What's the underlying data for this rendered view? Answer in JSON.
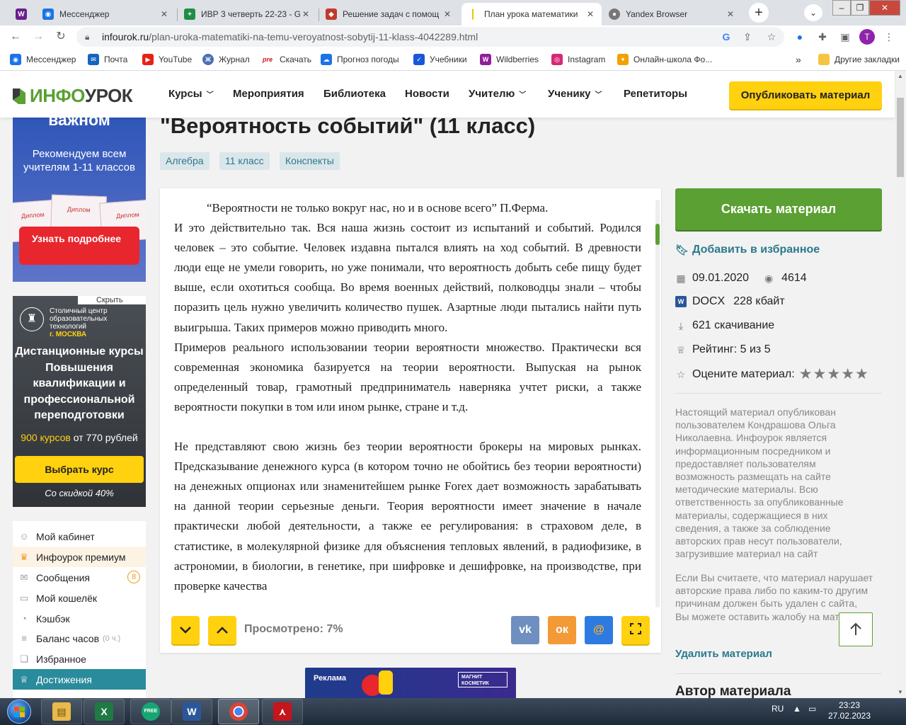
{
  "browser": {
    "tabs": [
      {
        "label": "",
        "icon": "W",
        "color": "#6b1e8c"
      },
      {
        "label": "Мессенджер",
        "icon": "◉",
        "color": "#1a73e8"
      },
      {
        "label": "ИВР 3 четверть 22-23 - G",
        "icon": "+",
        "color": "#1f8e45"
      },
      {
        "label": "Решение задач с помощ",
        "icon": "◆",
        "color": "#c0392b"
      },
      {
        "label": "План урока математики",
        "icon": "|",
        "color": "#f2c200"
      },
      {
        "label": "Yandex Browser",
        "icon": "●",
        "color": "#555555"
      }
    ],
    "active_tab": 4,
    "url_host": "infourok.ru",
    "url_path": "/plan-uroka-matematiki-na-temu-veroyatnost-sobytij-11-klass-4042289.html",
    "profile_letter": "T",
    "bookmarks": [
      {
        "label": "Мессенджер",
        "color": "#1a73e8",
        "icon": "◉"
      },
      {
        "label": "Почта",
        "color": "#1565c0",
        "icon": "✉"
      },
      {
        "label": "YouTube",
        "color": "#e62117",
        "icon": "▶"
      },
      {
        "label": "Журнал",
        "color": "#4a6fb5",
        "icon": "Ж"
      },
      {
        "label": "Скачать",
        "color": "#d7141a",
        "icon": "pre"
      },
      {
        "label": "Прогноз погоды",
        "color": "#1a73e8",
        "icon": "☁"
      },
      {
        "label": "Учебники",
        "color": "#1a56db",
        "icon": "✓"
      },
      {
        "label": "Wildberries",
        "color": "#8e1f9a",
        "icon": "W"
      },
      {
        "label": "Instagram",
        "color": "#d62976",
        "icon": "◎"
      },
      {
        "label": "Онлайн-школа Фо...",
        "color": "#f2a100",
        "icon": "✦"
      }
    ],
    "more_bookmarks": "»",
    "other_bookmarks": "Другие закладки"
  },
  "site": {
    "logo_info": "ИНФО",
    "logo_urok": "УРОК",
    "nav": [
      {
        "label": "Курсы",
        "dropdown": true
      },
      {
        "label": "Мероприятия",
        "dropdown": false
      },
      {
        "label": "Библиотека",
        "dropdown": false
      },
      {
        "label": "Новости",
        "dropdown": false
      },
      {
        "label": "Учителю",
        "dropdown": true
      },
      {
        "label": "Ученику",
        "dropdown": true
      },
      {
        "label": "Репетиторы",
        "dropdown": false
      }
    ],
    "publish_label": "Опубликовать материал"
  },
  "left_ads": {
    "ad1_heading": "важном",
    "ad1_sub": "Рекомендуем всем учителям 1-11 классов",
    "ad1_diploma": "Диплом",
    "ad1_cta": "Узнать подробнее",
    "ad2_hide": "Скрыть",
    "ad2_org": "Столичный центр образовательных технологий",
    "ad2_city": "г. МОСКВА",
    "ad2_title": "Дистанционные курсы Повышения квалификации и профессиональной переподготовки",
    "ad2_price_hl": "900 курсов",
    "ad2_price_rest": " от 770 рублей",
    "ad2_btn": "Выбрать курс",
    "ad2_discount": "Со скидкой 40%"
  },
  "user_menu": [
    {
      "label": "Мой кабинет",
      "icon": "☺",
      "muted": "",
      "badge": ""
    },
    {
      "label": "Инфоурок премиум",
      "icon": "♛",
      "muted": "",
      "badge": ""
    },
    {
      "label": "Сообщения",
      "icon": "✉",
      "muted": "",
      "badge": "8"
    },
    {
      "label": "Мой кошелёк",
      "icon": "▭",
      "muted": "",
      "badge": ""
    },
    {
      "label": "Кэшбэк",
      "icon": "◔",
      "muted": "",
      "badge": ""
    },
    {
      "label": "Баланс часов",
      "icon": "≡",
      "muted": "(0 ч.)",
      "badge": ""
    },
    {
      "label": "Избранное",
      "icon": "❏",
      "muted": "",
      "badge": ""
    },
    {
      "label": "Достижения",
      "icon": "♕",
      "muted": "",
      "badge": ""
    }
  ],
  "doc": {
    "title": "\"Вероятность событий\" (11 класс)",
    "tags": [
      "Алгебра",
      "11 класс",
      "Конспекты"
    ],
    "quote": "“Вероятности не только вокруг нас, но и в основе всего”   П.Ферма.",
    "para1": "И это действительно так. Вся наша жизнь состоит из испытаний и событий. Родился человек – это событие. Человек издавна пытался влиять на ход событий. В древности люди еще не умели говорить, но уже понимали, что вероятность добыть себе пищу будет выше, если охотиться сообща. Во время военных действий, полководцы знали – чтобы поразить цель нужно увеличить количество пушек. Азартные люди пытались найти путь выигрыша. Таких примеров можно приводить много.",
    "para2": "Примеров реального использовании теории вероятности множество. Практически вся современная экономика базируется на теории вероятности. Выпуская на рынок определенный товар, грамотный предприниматель наверняка учтет риски, а также вероятности покупки в том или ином рынке, стране и т.д.",
    "para3": "Не представляют свою жизнь без теории вероятности брокеры на мировых рынках. Предсказывание денежного курса (в котором точно не обойтись без теории вероятности) на денежных опционах или знаменитейшем рынке Forex дает возможность зарабатывать на данной теории серьезные деньги. Теория вероятности имеет значение в начале практически любой деятельности, а также ее регулирования: в страховом деле, в статистике, в молекулярной физике для объяснения тепловых явлений, в радиофизике, в астрономии, в биологии, в генетике, при шифровке и дешифровке, на производстве, при проверке качества",
    "viewed_label": "Просмотрено: 7%",
    "viewed_fraction": 0.07,
    "share": [
      {
        "label": "vk",
        "color": "#6f8fc0"
      },
      {
        "label": "ок",
        "color": "#f39a36"
      },
      {
        "label": "@",
        "color": "#2d7be0"
      }
    ]
  },
  "ad3": {
    "label": "Реклама",
    "brand": "МАГНИТ КОСМЕТИК"
  },
  "sidebar": {
    "download_label": "Скачать материал",
    "favorite_label": "Добавить в избранное",
    "date": "09.01.2020",
    "views": "4614",
    "format": "DOCX",
    "size": "228 кбайт",
    "downloads": "621 скачивание",
    "rating": "Рейтинг: 5 из 5",
    "rate_label": "Оцените материал:",
    "stars": 5,
    "legal1": "Настоящий материал опубликован пользователем Кондрашова Ольга Николаевна. Инфоурок является информационным посредником и предоставляет пользователям возможность размещать на сайте методические материалы. Всю ответственность за опубликованные материалы, содержащиеся в них сведения, а также за соблюдение авторских прав несут пользователи, загрузившие материал на сайт",
    "legal2": "Если Вы считаете, что материал нарушает авторские права либо по каким-то другим причинам должен быть удален с сайта, Вы можете оставить жалобу на материал.",
    "delete_label": "Удалить материал",
    "author_heading": "Автор материала"
  },
  "taskbar": {
    "apps": [
      {
        "name": "explorer",
        "icon": "▤",
        "color": "#e9b949"
      },
      {
        "name": "excel",
        "icon": "X",
        "color": "#1f7a44"
      },
      {
        "name": "free-app",
        "icon": "FREE",
        "color": "#17a673"
      },
      {
        "name": "word",
        "icon": "W",
        "color": "#2b579a"
      },
      {
        "name": "chrome",
        "icon": "◉",
        "color": "#4285f4"
      },
      {
        "name": "pdf",
        "icon": "⋏",
        "color": "#c4161c"
      }
    ],
    "lang": "RU",
    "time": "23:23",
    "date": "27.02.2023"
  },
  "colors": {
    "brand_green": "#5aa032",
    "brand_yellow": "#ffd10f",
    "link_teal": "#2a7a8c"
  }
}
